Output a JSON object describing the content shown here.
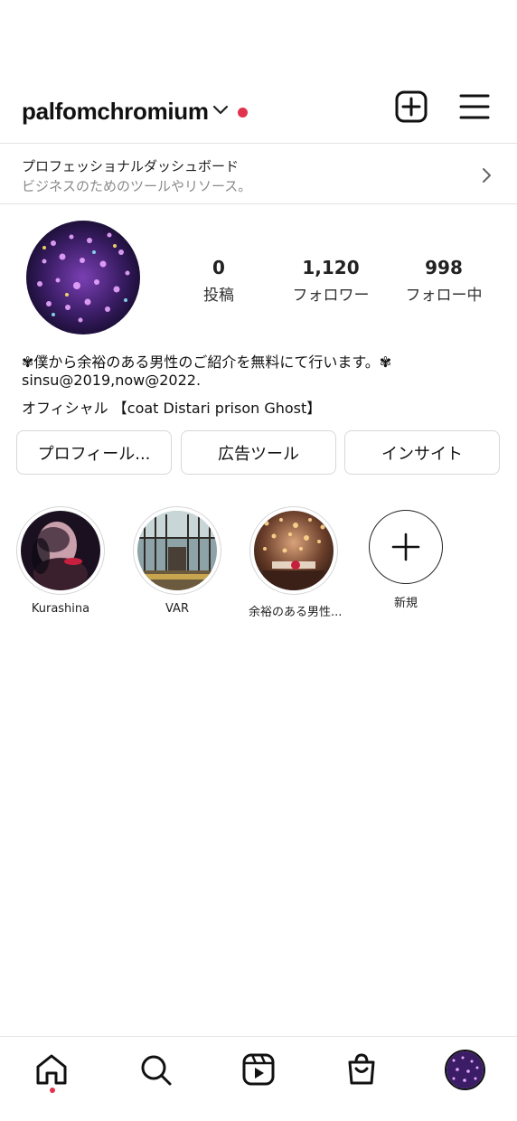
{
  "header": {
    "username": "palfomchromium",
    "notification_dot_color": "#e0334d",
    "add_icon": "plus-square-icon",
    "menu_icon": "hamburger-menu-icon"
  },
  "dashboard": {
    "title": "プロフェッショナルダッシュボード",
    "subtitle": "ビジネスのためのツールやリソース。"
  },
  "profile": {
    "stats": [
      {
        "value": "0",
        "label": "投稿"
      },
      {
        "value": "1,120",
        "label": "フォロワー"
      },
      {
        "value": "998",
        "label": "フォロー中"
      }
    ],
    "bio": [
      "✾僕から余裕のある男性のご紹介を無料にて行います。✾",
      "sinsu@2019,now@2022.",
      "オフィシャル 【coat Distari prison Ghost】"
    ]
  },
  "buttons": {
    "profile": "プロフィール...",
    "ads": "広告ツール",
    "insights": "インサイト"
  },
  "highlights": [
    {
      "label": "Kurashina"
    },
    {
      "label": "VAR"
    },
    {
      "label": "余裕のある男性..."
    },
    {
      "label": "新規"
    }
  ],
  "nav": {
    "items": [
      "home-icon",
      "search-icon",
      "reels-icon",
      "shop-icon",
      "profile-avatar"
    ],
    "active_dot_color": "#e0334d"
  }
}
